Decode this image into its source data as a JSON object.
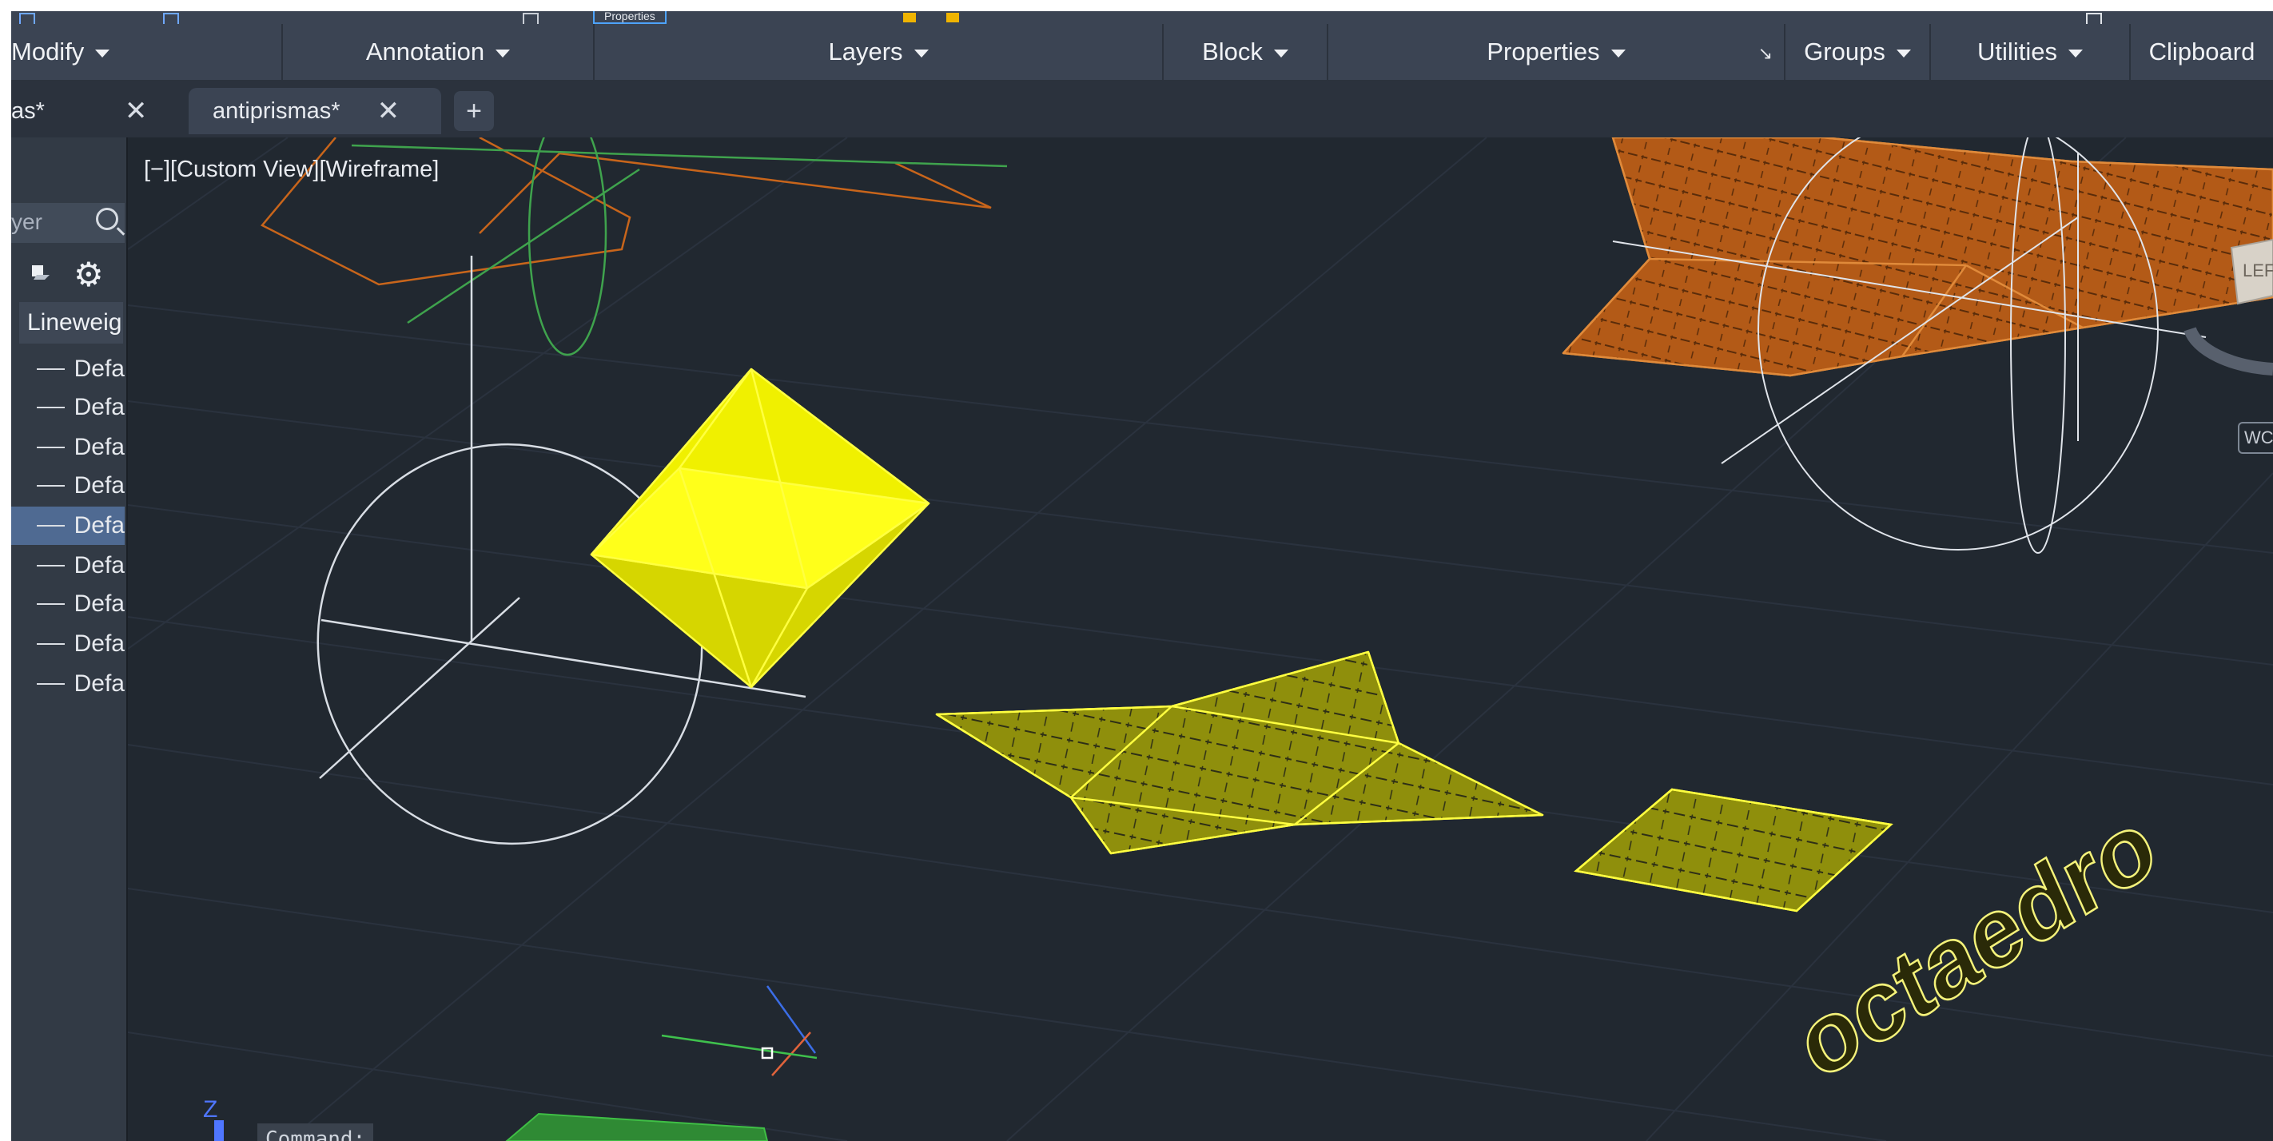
{
  "ribbon": {
    "top_chip": "Properties",
    "panels": [
      {
        "label": "Modify"
      },
      {
        "label": "Annotation"
      },
      {
        "label": "Layers"
      },
      {
        "label": "Block"
      },
      {
        "label": "Properties"
      },
      {
        "label": "Groups"
      },
      {
        "label": "Utilities"
      },
      {
        "label": "Clipboard"
      }
    ],
    "launcher": "↘"
  },
  "tabs": [
    {
      "label": "as*"
    },
    {
      "label": "antiprismas*"
    }
  ],
  "tab_close_glyph": "✕",
  "tab_new_glyph": "+",
  "palette": {
    "search_text": "yer",
    "header": "Lineweig",
    "rows": [
      "Defa",
      "Defa",
      "Defa",
      "Defa",
      "Defa",
      "Defa",
      "Defa",
      "Defa",
      "Defa"
    ],
    "selected_row": 4
  },
  "viewport": {
    "label": "[−][Custom View][Wireframe]",
    "text_3d": "octaedro",
    "viewcube_face": "LEF",
    "wcs": "WC",
    "ucs_axis": "Z"
  },
  "command": {
    "prompt": "Command:"
  },
  "colors": {
    "background": "#212830",
    "ribbon": "#3b4453",
    "yellow": "#e6e600",
    "orange": "#c8651b",
    "green": "#3fa34d"
  }
}
